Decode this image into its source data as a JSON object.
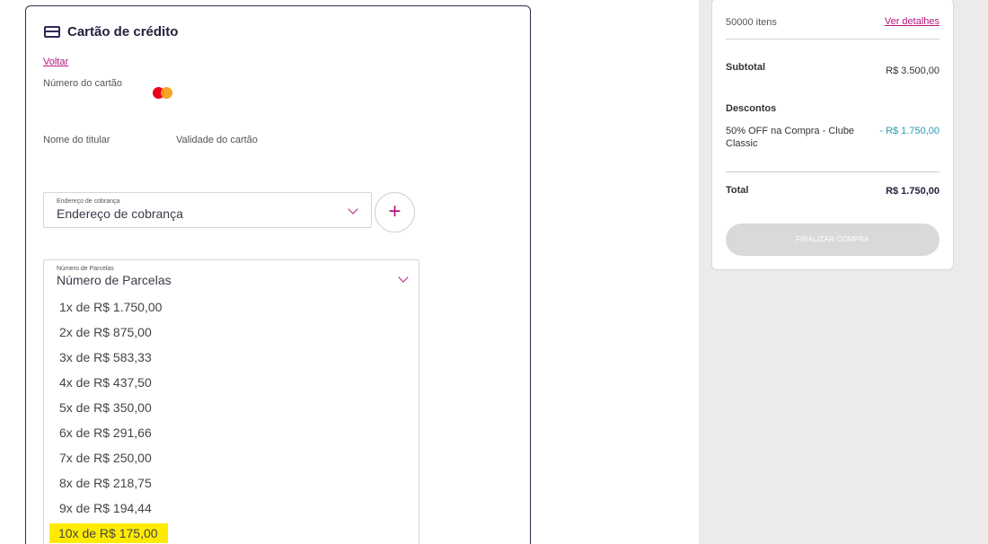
{
  "payment": {
    "title": "Cartão de crédito",
    "back_link": "Voltar",
    "card_number_label": "Número do cartão",
    "card_holder_label": "Nome do titular",
    "card_expiry_label": "Validade do cartão",
    "billing": {
      "mini_label": "Endereço de cobrança",
      "value": "Endereço de cobrança"
    },
    "add_button": "+",
    "installments": {
      "mini_label": "Número de Parcelas",
      "value": "Número de Parcelas",
      "options": [
        "1x de R$ 1.750,00",
        "2x de R$ 875,00",
        "3x de R$ 583,33",
        "4x de R$ 437,50",
        "5x de R$ 350,00",
        "6x de R$ 291,66",
        "7x de R$ 250,00",
        "8x de R$ 218,75",
        "9x de R$ 194,44",
        "10x de R$ 175,00"
      ],
      "highlighted_index": 9
    }
  },
  "summary": {
    "items_count": "50000 itens",
    "details_link": "Ver detalhes",
    "subtotal_label": "Subtotal",
    "subtotal_value": "R$ 3.500,00",
    "discounts_label": "Descontos",
    "discount_line1": "50% OFF na Compra - Clube",
    "discount_line2": "Classic",
    "discount_value": "- R$ 1.750,00",
    "total_label": "Total",
    "total_value": "R$ 1.750,00",
    "finalize_button": "FINALIZAR COMPRA"
  },
  "colors": {
    "accent": "#b5157b",
    "highlight": "#ffeb00",
    "discount": "#2a9bb0",
    "panel_border": "#2c2a57"
  }
}
